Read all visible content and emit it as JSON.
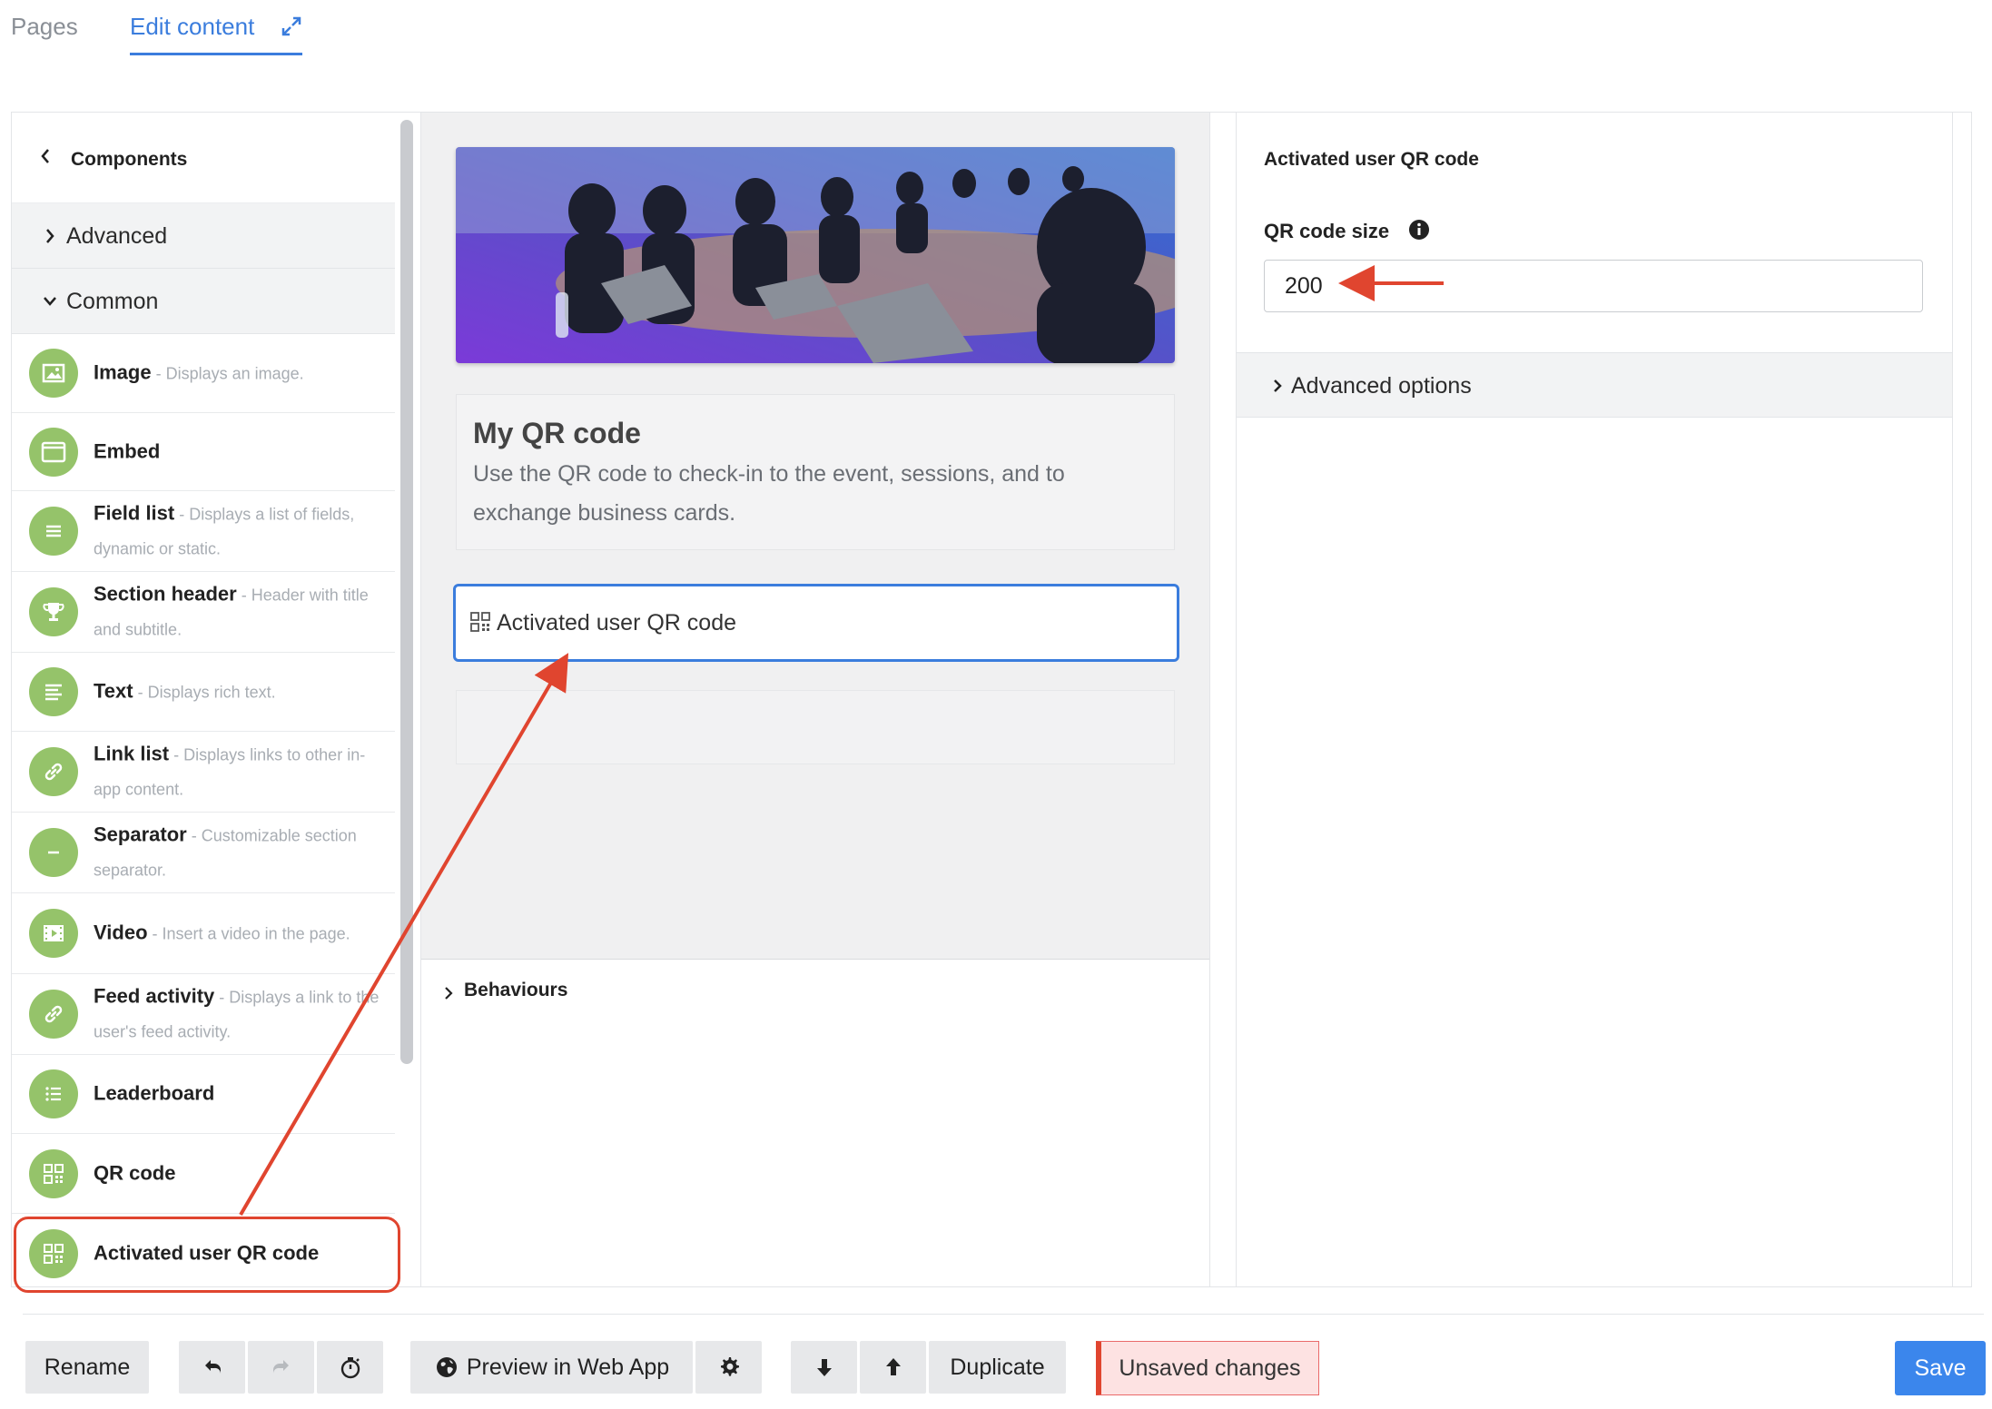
{
  "tabs": {
    "pages": "Pages",
    "edit_content": "Edit content"
  },
  "components_panel": {
    "header": "Components",
    "categories": {
      "advanced": "Advanced",
      "common": "Common"
    },
    "items": [
      {
        "name": "Image",
        "desc": " - Displays an image."
      },
      {
        "name": "Embed",
        "desc": ""
      },
      {
        "name": "Field list",
        "desc": " - Displays a list of fields, dynamic or static."
      },
      {
        "name": "Section header",
        "desc": " - Header with title and subtitle."
      },
      {
        "name": "Text",
        "desc": " - Displays rich text."
      },
      {
        "name": "Link list",
        "desc": " - Displays links to other in-app content."
      },
      {
        "name": "Separator",
        "desc": " - Customizable section separator."
      },
      {
        "name": "Video",
        "desc": " - Insert a video in the page."
      },
      {
        "name": "Feed activity",
        "desc": " - Displays a link to the user's feed activity."
      },
      {
        "name": "Leaderboard",
        "desc": ""
      },
      {
        "name": "QR code",
        "desc": ""
      },
      {
        "name": "Activated user QR code",
        "desc": ""
      }
    ]
  },
  "canvas": {
    "card_title": "My QR code",
    "card_desc": "Use the QR code to check-in to the event, sessions, and to exchange business cards.",
    "selected_block": "Activated user QR code",
    "behaviours": "Behaviours"
  },
  "settings": {
    "title": "Activated user QR code",
    "size_label": "QR code size",
    "size_value": "200",
    "advanced_options": "Advanced options"
  },
  "toolbar": {
    "rename": "Rename",
    "preview": "Preview in Web App",
    "duplicate": "Duplicate",
    "unsaved": "Unsaved changes",
    "save": "Save"
  },
  "colors": {
    "accent": "#3b7ddd",
    "icon_green": "#95c36a",
    "annotation_red": "#e0452f",
    "save_blue": "#3b86ec"
  }
}
